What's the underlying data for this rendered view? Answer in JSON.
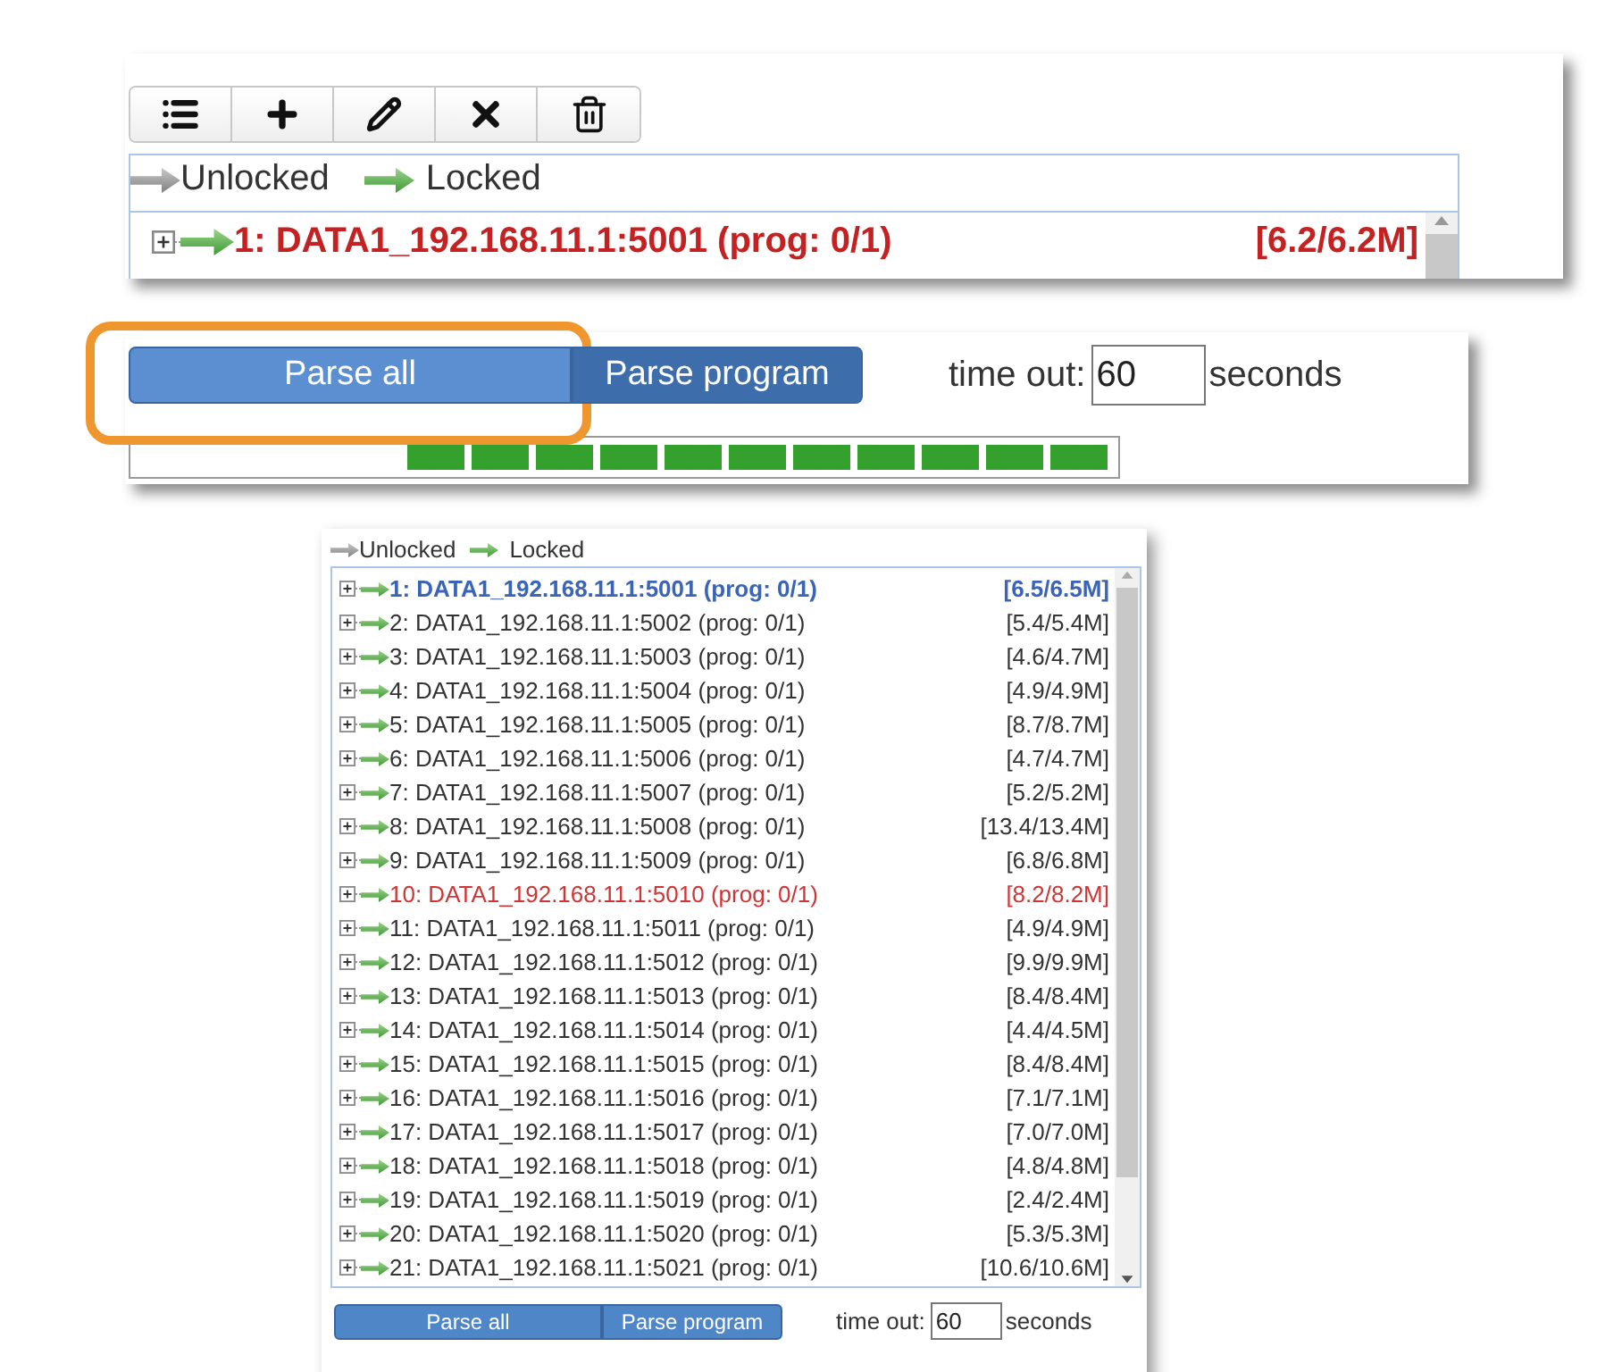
{
  "large_view": {
    "legend": {
      "unlocked": "Unlocked",
      "locked": "Locked"
    },
    "rows": [
      {
        "label": "1: DATA1_192.168.11.1:5001 (prog: 0/1)",
        "size": "[6.2/6.2M]",
        "color": "#c42222",
        "selected": true,
        "locked": true
      }
    ],
    "buttons": [
      {
        "label": "Parse all",
        "highlighted": true,
        "color": "#5b8fd1"
      },
      {
        "label": "Parse program",
        "highlighted": false,
        "color": "#3e6dab"
      }
    ],
    "timeout_label": "time out:",
    "timeout_value": "60",
    "timeout_unit": "seconds",
    "progress": {
      "level": 0.72
    }
  },
  "small_view": {
    "legend": {
      "unlocked": "Unlocked",
      "locked": "Locked"
    },
    "rows": [
      {
        "label": "1: DATA1_192.168.11.1:5001 (prog: 0/1)",
        "size": "[6.5/6.5M]",
        "color": "#3a64b8",
        "selected": true,
        "locked": true
      },
      {
        "label": "2: DATA1_192.168.11.1:5002 (prog: 0/1)",
        "size": "[5.4/5.4M]",
        "color": "#333333",
        "selected": false,
        "locked": true
      },
      {
        "label": "3: DATA1_192.168.11.1:5003 (prog: 0/1)",
        "size": "[4.6/4.7M]",
        "color": "#333333",
        "selected": false,
        "locked": true
      },
      {
        "label": "4: DATA1_192.168.11.1:5004 (prog: 0/1)",
        "size": "[4.9/4.9M]",
        "color": "#333333",
        "selected": false,
        "locked": true
      },
      {
        "label": "5: DATA1_192.168.11.1:5005 (prog: 0/1)",
        "size": "[8.7/8.7M]",
        "color": "#333333",
        "selected": false,
        "locked": true
      },
      {
        "label": "6: DATA1_192.168.11.1:5006 (prog: 0/1)",
        "size": "[4.7/4.7M]",
        "color": "#333333",
        "selected": false,
        "locked": true
      },
      {
        "label": "7: DATA1_192.168.11.1:5007 (prog: 0/1)",
        "size": "[5.2/5.2M]",
        "color": "#333333",
        "selected": false,
        "locked": true
      },
      {
        "label": "8: DATA1_192.168.11.1:5008 (prog: 0/1)",
        "size": "[13.4/13.4M]",
        "color": "#333333",
        "selected": false,
        "locked": true
      },
      {
        "label": "9: DATA1_192.168.11.1:5009 (prog: 0/1)",
        "size": "[6.8/6.8M]",
        "color": "#333333",
        "selected": false,
        "locked": true
      },
      {
        "label": "10: DATA1_192.168.11.1:5010 (prog: 0/1)",
        "size": "[8.2/8.2M]",
        "color": "#d03434",
        "selected": false,
        "locked": true
      },
      {
        "label": "11: DATA1_192.168.11.1:5011 (prog: 0/1)",
        "size": "[4.9/4.9M]",
        "color": "#333333",
        "selected": false,
        "locked": true
      },
      {
        "label": "12: DATA1_192.168.11.1:5012 (prog: 0/1)",
        "size": "[9.9/9.9M]",
        "color": "#333333",
        "selected": false,
        "locked": true
      },
      {
        "label": "13: DATA1_192.168.11.1:5013 (prog: 0/1)",
        "size": "[8.4/8.4M]",
        "color": "#333333",
        "selected": false,
        "locked": true
      },
      {
        "label": "14: DATA1_192.168.11.1:5014 (prog: 0/1)",
        "size": "[4.4/4.5M]",
        "color": "#333333",
        "selected": false,
        "locked": true
      },
      {
        "label": "15: DATA1_192.168.11.1:5015 (prog: 0/1)",
        "size": "[8.4/8.4M]",
        "color": "#333333",
        "selected": false,
        "locked": true
      },
      {
        "label": "16: DATA1_192.168.11.1:5016 (prog: 0/1)",
        "size": "[7.1/7.1M]",
        "color": "#333333",
        "selected": false,
        "locked": true
      },
      {
        "label": "17: DATA1_192.168.11.1:5017 (prog: 0/1)",
        "size": "[7.0/7.0M]",
        "color": "#333333",
        "selected": false,
        "locked": true
      },
      {
        "label": "18: DATA1_192.168.11.1:5018 (prog: 0/1)",
        "size": "[4.8/4.8M]",
        "color": "#333333",
        "selected": false,
        "locked": true
      },
      {
        "label": "19: DATA1_192.168.11.1:5019 (prog: 0/1)",
        "size": "[2.4/2.4M]",
        "color": "#333333",
        "selected": false,
        "locked": true
      },
      {
        "label": "20: DATA1_192.168.11.1:5020 (prog: 0/1)",
        "size": "[5.3/5.3M]",
        "color": "#333333",
        "selected": false,
        "locked": true
      },
      {
        "label": "21: DATA1_192.168.11.1:5021 (prog: 0/1)",
        "size": "[10.6/10.6M]",
        "color": "#333333",
        "selected": false,
        "locked": true
      }
    ],
    "buttons": [
      {
        "label": "Parse all"
      },
      {
        "label": "Parse program"
      }
    ],
    "timeout_label": "time out:",
    "timeout_value": "60",
    "timeout_unit": "seconds"
  }
}
